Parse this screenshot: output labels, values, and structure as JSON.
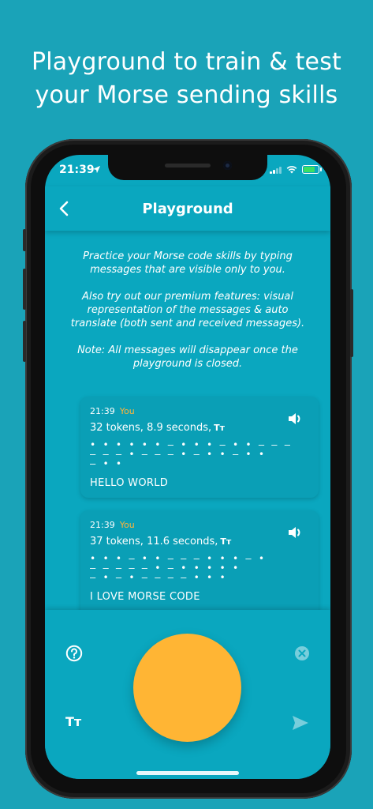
{
  "headline": {
    "line1": "Playground to train & test",
    "line2": "your Morse sending skills"
  },
  "statusbar": {
    "time": "21:39"
  },
  "nav": {
    "title": "Playground",
    "back_icon": "chevron-left-icon"
  },
  "intro": {
    "p1": "Practice your Morse code skills by typing messages that are visible only to you.",
    "p2": "Also try out our premium features: visual representation of the messages & auto translate (both sent and received messages).",
    "p3": "Note: All messages will disappear once the playground is closed."
  },
  "messages": [
    {
      "time": "21:39",
      "sender": "You",
      "stats": "32 tokens, 8.9 seconds,",
      "tt": "Tт",
      "morse": [
        "• • • •   •   • — • •   • — • •   — — —",
        "  — — —   • — — —   • — •   • — • •",
        "— • •"
      ],
      "text": "HELLO WORLD"
    },
    {
      "time": "21:39",
      "sender": "You",
      "stats": "37 tokens, 11.6 seconds,",
      "tt": "Tт",
      "morse": [
        "• •   • — • •   — — —   • • • —   •",
        "— —   — — —   • — •   • • •   •",
        "— • — •   — — —   — • •   •"
      ],
      "text": "I LOVE MORSE CODE"
    }
  ],
  "bottom": {
    "font_label": "Tт"
  },
  "colors": {
    "accent": "#ffb534",
    "background": "#1aa3b8",
    "screen": "#0aa7bf"
  }
}
